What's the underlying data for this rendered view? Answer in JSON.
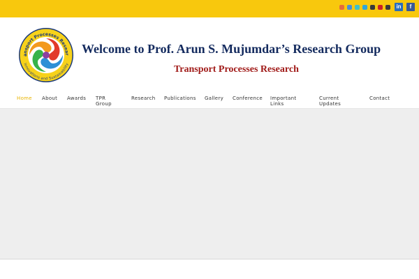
{
  "topbar": {
    "color": "#f8c80d",
    "social": [
      {
        "name": "email-icon",
        "color": "#e56b3b"
      },
      {
        "name": "blogger-icon",
        "color": "#4a8ed4"
      },
      {
        "name": "vimeo-icon",
        "color": "#3fc0c9"
      },
      {
        "name": "share-icon",
        "color": "#2fa6d9"
      },
      {
        "name": "flickr-icon",
        "color": "#3a3a3a"
      },
      {
        "name": "pinterest-icon",
        "color": "#cb2027"
      },
      {
        "name": "tumblr-icon",
        "color": "#3a3a3a"
      }
    ],
    "linkedin_label": "in",
    "facebook_label": "f"
  },
  "header": {
    "title": "Welcome to Prof. Arun S. Mujumdar’s Research Group",
    "subtitle": "Transport Processes Research",
    "logo": {
      "top_text": "Transport Processes Research",
      "bottom_text": "Innovations and Sustainability"
    }
  },
  "nav": {
    "items": [
      {
        "label": "Home",
        "active": true
      },
      {
        "label": "About"
      },
      {
        "label": "Awards"
      },
      {
        "label": "TPR\nGroup"
      },
      {
        "label": "Research"
      },
      {
        "label": "Publications"
      },
      {
        "label": "Gallery"
      },
      {
        "label": "Conference"
      },
      {
        "label": "Important\nLinks"
      },
      {
        "label": "Current\nUpdates"
      },
      {
        "label": "Contact"
      }
    ]
  }
}
